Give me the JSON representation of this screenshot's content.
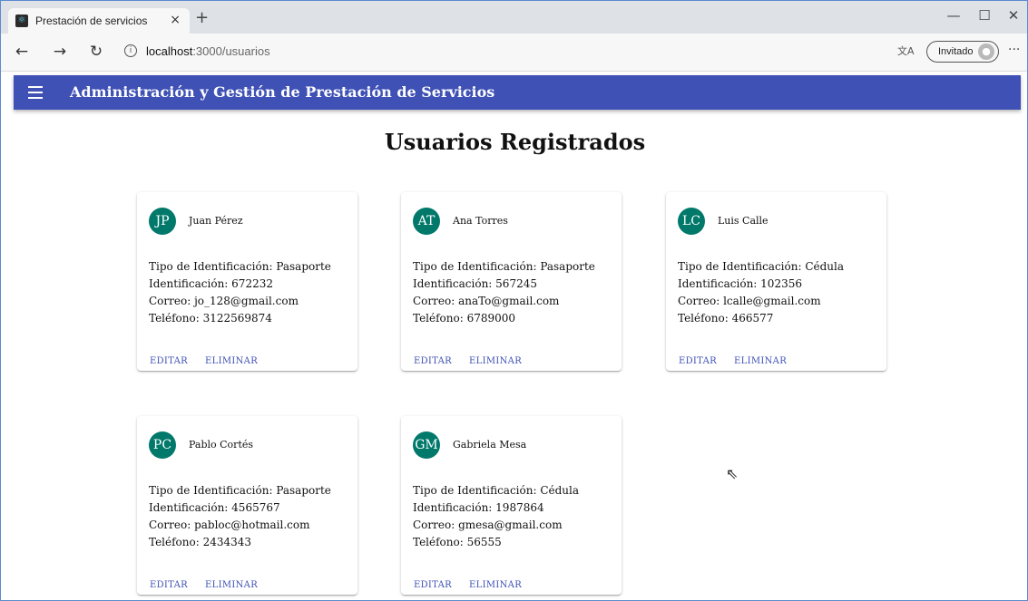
{
  "browser": {
    "tab_title": "Prestación de servicios",
    "tab_close": "×",
    "new_tab": "+",
    "url_host": "localhost",
    "url_path": ":3000/usuarios",
    "profile_label": "Invitado",
    "window_controls": {
      "minimize": "—",
      "maximize": "☐",
      "close": "✕"
    },
    "nav": {
      "back": "←",
      "forward": "→",
      "refresh": "↻"
    }
  },
  "appbar": {
    "title": "Administración y Gestión de Prestación de Servicios",
    "color": "#3f51b5"
  },
  "page": {
    "title": "Usuarios Registrados"
  },
  "labels": {
    "tipo": "Tipo de Identificación: ",
    "identificacion": "Identificación: ",
    "correo": "Correo: ",
    "telefono": "Teléfono: ",
    "edit": "EDITAR",
    "delete": "ELIMINAR"
  },
  "avatar_color": "#00796b",
  "users": [
    {
      "initials": "JP",
      "name": "Juan Pérez",
      "tipo": "Pasaporte",
      "identificacion": "672232",
      "correo": "jo_128@gmail.com",
      "telefono": "3122569874"
    },
    {
      "initials": "AT",
      "name": "Ana Torres",
      "tipo": "Pasaporte",
      "identificacion": "567245",
      "correo": "anaTo@gmail.com",
      "telefono": "6789000"
    },
    {
      "initials": "LC",
      "name": "Luis Calle",
      "tipo": "Cédula",
      "identificacion": "102356",
      "correo": "lcalle@gmail.com",
      "telefono": "466577"
    },
    {
      "initials": "PC",
      "name": "Pablo Cortés",
      "tipo": "Pasaporte",
      "identificacion": "4565767",
      "correo": "pabloc@hotmail.com",
      "telefono": "2434343"
    },
    {
      "initials": "GM",
      "name": "Gabriela Mesa",
      "tipo": "Cédula",
      "identificacion": "1987864",
      "correo": "gmesa@gmail.com",
      "telefono": "56555"
    }
  ]
}
